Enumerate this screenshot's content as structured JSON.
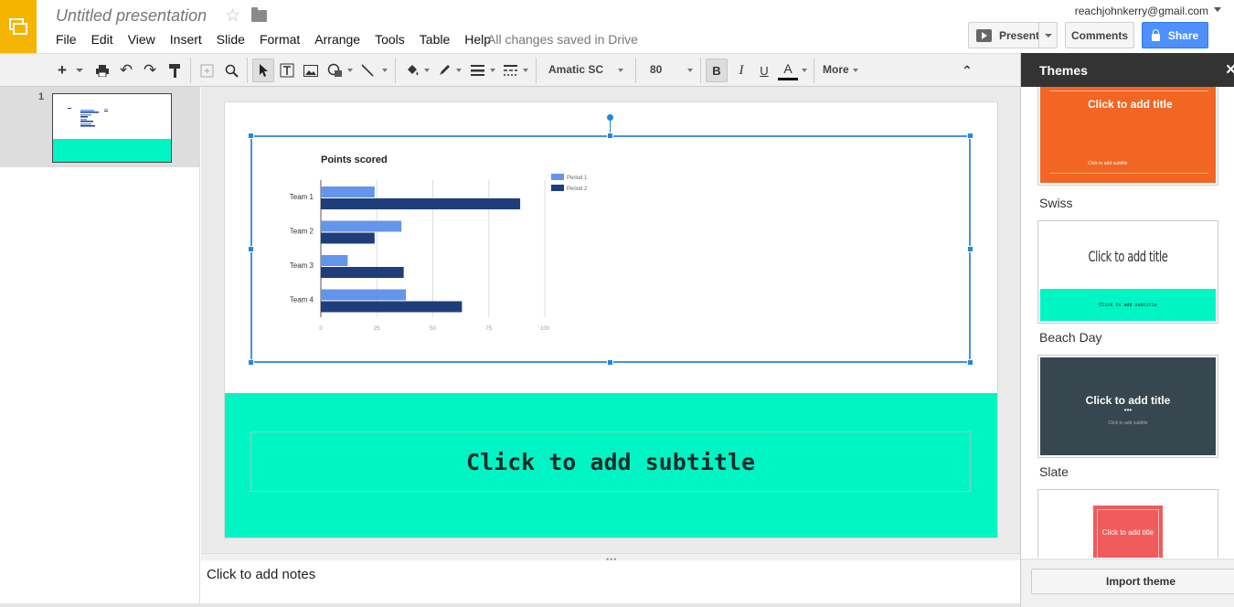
{
  "header": {
    "doc_title": "Untitled presentation",
    "save_status": "All changes saved in Drive",
    "account_email": "reachjohnkerry@gmail.com",
    "present_label": "Present",
    "comments_label": "Comments",
    "share_label": "Share"
  },
  "menus": [
    "File",
    "Edit",
    "View",
    "Insert",
    "Slide",
    "Format",
    "Arrange",
    "Tools",
    "Table",
    "Help"
  ],
  "toolbar": {
    "font_family": "Amatic SC",
    "font_size": "80",
    "bold_label": "B",
    "italic_label": "I",
    "underline_label": "U",
    "text_color_label": "A",
    "more_label": "More"
  },
  "filmstrip": {
    "slide_number": "1"
  },
  "slide": {
    "subtitle_placeholder": "Click to add subtitle",
    "accent_color": "#00f5c4"
  },
  "notes": {
    "placeholder": "Click to add notes"
  },
  "themes": {
    "title": "Themes",
    "import_label": "Import theme",
    "items": [
      {
        "name": "Swiss",
        "title_text": "Click to add title",
        "subtitle_text": "Click to add subtitle",
        "bg": "#f26522"
      },
      {
        "name": "Beach Day",
        "title_text": "Click to add title",
        "subtitle_text": "Click to add subtitle",
        "bg": "#00f5c4"
      },
      {
        "name": "Slate",
        "title_text": "Click to add title",
        "subtitle_text": "Click to add subtitle",
        "bg": "#37474f"
      },
      {
        "name": "",
        "title_text": "Click to add title",
        "subtitle_text": "",
        "bg": "#f05b5b"
      }
    ]
  },
  "chart_data": {
    "type": "bar",
    "orientation": "horizontal",
    "title": "Points scored",
    "categories": [
      "Team 1",
      "Team 2",
      "Team 3",
      "Team 4"
    ],
    "series": [
      {
        "name": "Period 1",
        "values": [
          24,
          36,
          12,
          38
        ],
        "color": "#6495ed"
      },
      {
        "name": "Period 2",
        "values": [
          89,
          24,
          37,
          63
        ],
        "color": "#1f3d7a"
      }
    ],
    "xlim": [
      0,
      100
    ],
    "x_ticks": [
      "0",
      "25",
      "50",
      "75",
      "100"
    ],
    "grid": true,
    "legend": "right"
  }
}
